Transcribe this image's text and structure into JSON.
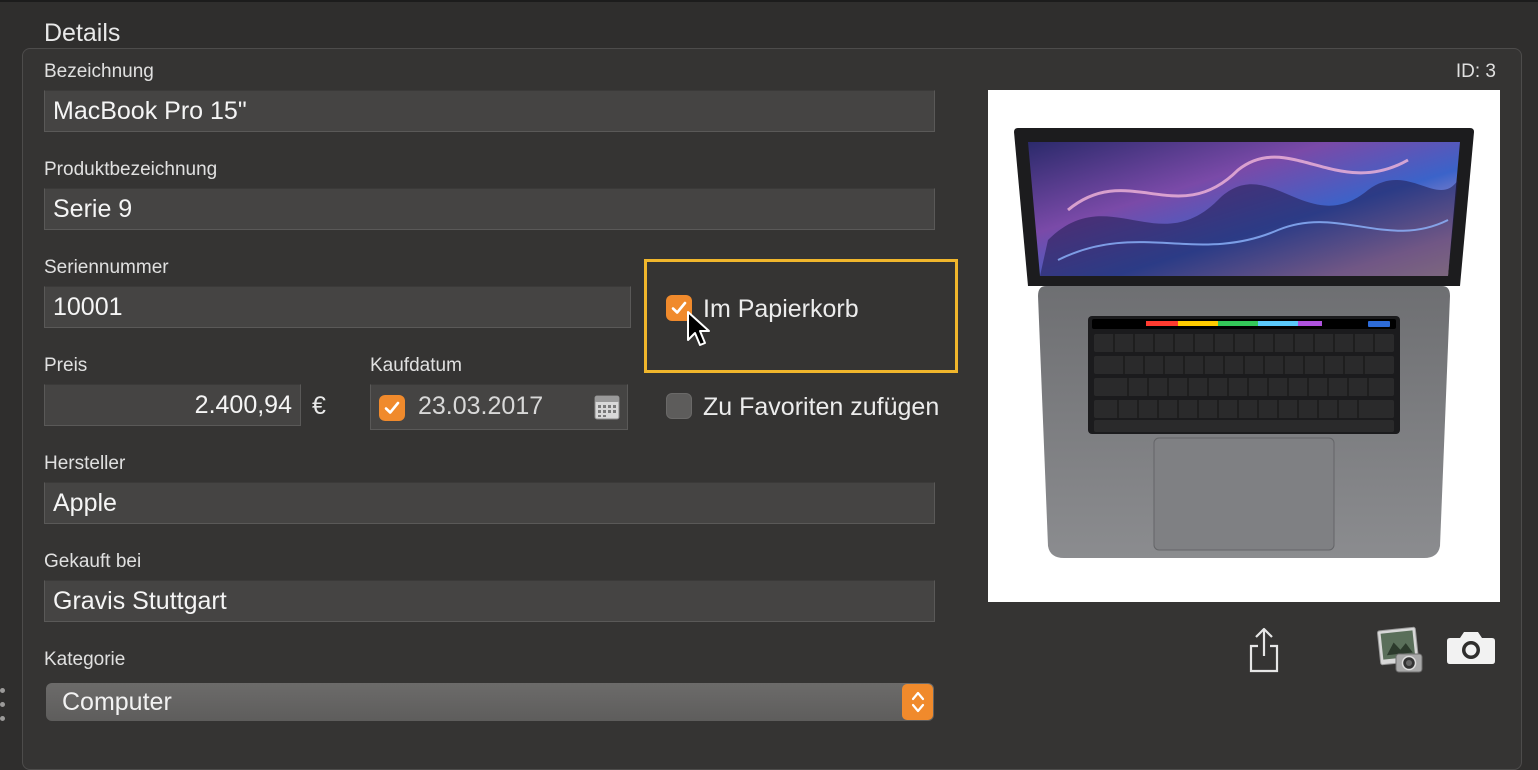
{
  "section": {
    "title": "Details"
  },
  "record": {
    "id_label": "ID: 3"
  },
  "fields": {
    "bezeichnung": {
      "label": "Bezeichnung",
      "value": "MacBook Pro 15\""
    },
    "produktbezeichnung": {
      "label": "Produktbezeichnung",
      "value": "Serie 9"
    },
    "seriennummer": {
      "label": "Seriennummer",
      "value": "10001"
    },
    "preis": {
      "label": "Preis",
      "value": "2.400,94",
      "currency": "€"
    },
    "kaufdatum": {
      "label": "Kaufdatum",
      "value": "23.03.2017",
      "enabled": true
    },
    "hersteller": {
      "label": "Hersteller",
      "value": "Apple"
    },
    "gekauft_bei": {
      "label": "Gekauft bei",
      "value": "Gravis Stuttgart"
    },
    "kategorie": {
      "label": "Kategorie",
      "value": "Computer"
    }
  },
  "checkboxes": {
    "papierkorb": {
      "label": "Im Papierkorb",
      "checked": true
    },
    "favoriten": {
      "label": "Zu Favoriten zufügen",
      "checked": false
    }
  },
  "icons": {
    "calendar": "calendar-icon",
    "share": "share-icon",
    "iphoto": "iphoto-icon",
    "camera": "camera-icon",
    "cursor": "mouse-cursor-icon"
  },
  "colors": {
    "accent": "#f08a2c",
    "highlight": "#f0b62c",
    "background": "#2f2e2d",
    "field": "#454443"
  }
}
